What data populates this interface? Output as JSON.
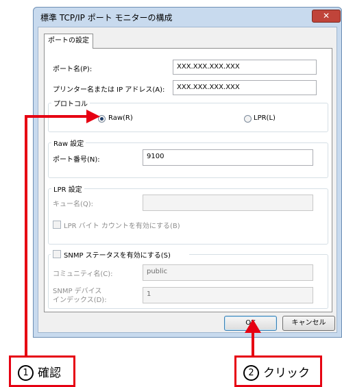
{
  "window": {
    "title": "標準 TCP/IP ポート モニターの構成",
    "close_glyph": "✕"
  },
  "tab": {
    "label": "ポートの設定"
  },
  "port_name": {
    "label": "ポート名(P):",
    "value": "XXX.XXX.XXX.XXX"
  },
  "printer_name": {
    "label": "プリンター名または IP アドレス(A):",
    "value": "XXX.XXX.XXX.XXX"
  },
  "protocol": {
    "legend": "プロトコル",
    "raw_label": "Raw(R)",
    "lpr_label": "LPR(L)",
    "selected": "Raw"
  },
  "raw_settings": {
    "legend": "Raw 設定",
    "port_number_label": "ポート番号(N):",
    "port_number_value": "9100"
  },
  "lpr_settings": {
    "legend": "LPR 設定",
    "queue_label": "キュー名(Q):",
    "queue_value": "",
    "byte_count_label": "LPR バイト カウントを有効にする(B)",
    "byte_count_checked": false
  },
  "snmp": {
    "enable_label": "SNMP ステータスを有効にする(S)",
    "enabled": false,
    "community_label": "コミュニティ名(C):",
    "community_value": "public",
    "device_index_label_line1": "SNMP デバイス",
    "device_index_label_line2": "インデックス(D):",
    "device_index_value": "1"
  },
  "buttons": {
    "ok": "OK",
    "cancel": "キャンセル"
  },
  "annotations": {
    "step1_number": "1",
    "step1_text": "確認",
    "step2_number": "2",
    "step2_text": "クリック",
    "color": "#e60012"
  }
}
